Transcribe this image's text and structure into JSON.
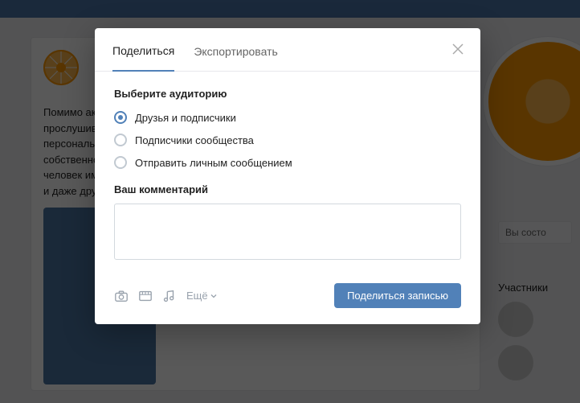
{
  "background": {
    "post_text_lines": [
      "Помимо акт",
      "прослушив",
      "персональн",
      "собственно",
      "человек им",
      "и даже друз"
    ],
    "status_text": "Вы состо",
    "participants_label": "Участники"
  },
  "modal": {
    "tabs": {
      "share": "Поделиться",
      "export": "Экспортировать"
    },
    "audience": {
      "title": "Выберите аудиторию",
      "options": {
        "friends": "Друзья и подписчики",
        "community": "Подписчики сообщества",
        "pm": "Отправить личным сообщением"
      }
    },
    "comment_label": "Ваш комментарий",
    "more_label": "Ещё",
    "share_button": "Поделиться записью"
  }
}
